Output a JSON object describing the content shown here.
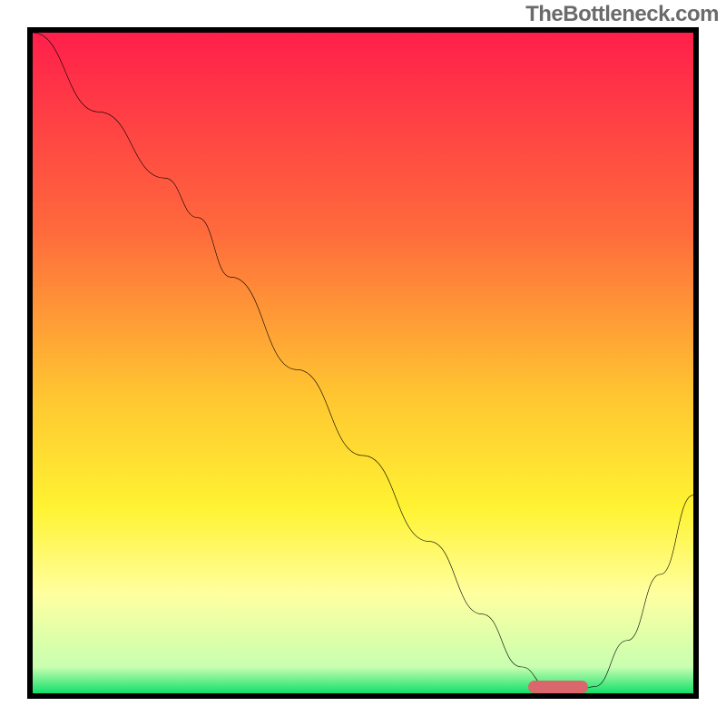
{
  "watermark": "TheBottleneck.com",
  "chart_data": {
    "type": "line",
    "title": "",
    "xlabel": "",
    "ylabel": "",
    "xlim": [
      0,
      100
    ],
    "ylim": [
      0,
      100
    ],
    "grid": false,
    "legend": false,
    "background_gradient": {
      "stops": [
        {
          "pos": 0.0,
          "color": "#ff1f4b"
        },
        {
          "pos": 0.3,
          "color": "#ff6a3c"
        },
        {
          "pos": 0.55,
          "color": "#ffc631"
        },
        {
          "pos": 0.72,
          "color": "#fff332"
        },
        {
          "pos": 0.85,
          "color": "#ffffa0"
        },
        {
          "pos": 0.96,
          "color": "#c8ffb0"
        },
        {
          "pos": 1.0,
          "color": "#11e06a"
        }
      ]
    },
    "series": [
      {
        "name": "bottleneck-curve",
        "x": [
          0,
          10,
          20,
          25,
          30,
          40,
          50,
          60,
          68,
          74,
          78,
          82,
          85,
          90,
          95,
          100
        ],
        "y": [
          100,
          88,
          78,
          72,
          63,
          49,
          36,
          23,
          12,
          4,
          1,
          0,
          1,
          8,
          18,
          30
        ]
      }
    ],
    "marker": {
      "name": "optimal-range",
      "x_start": 75,
      "x_end": 84,
      "y": 0,
      "color": "#d9676b"
    }
  }
}
